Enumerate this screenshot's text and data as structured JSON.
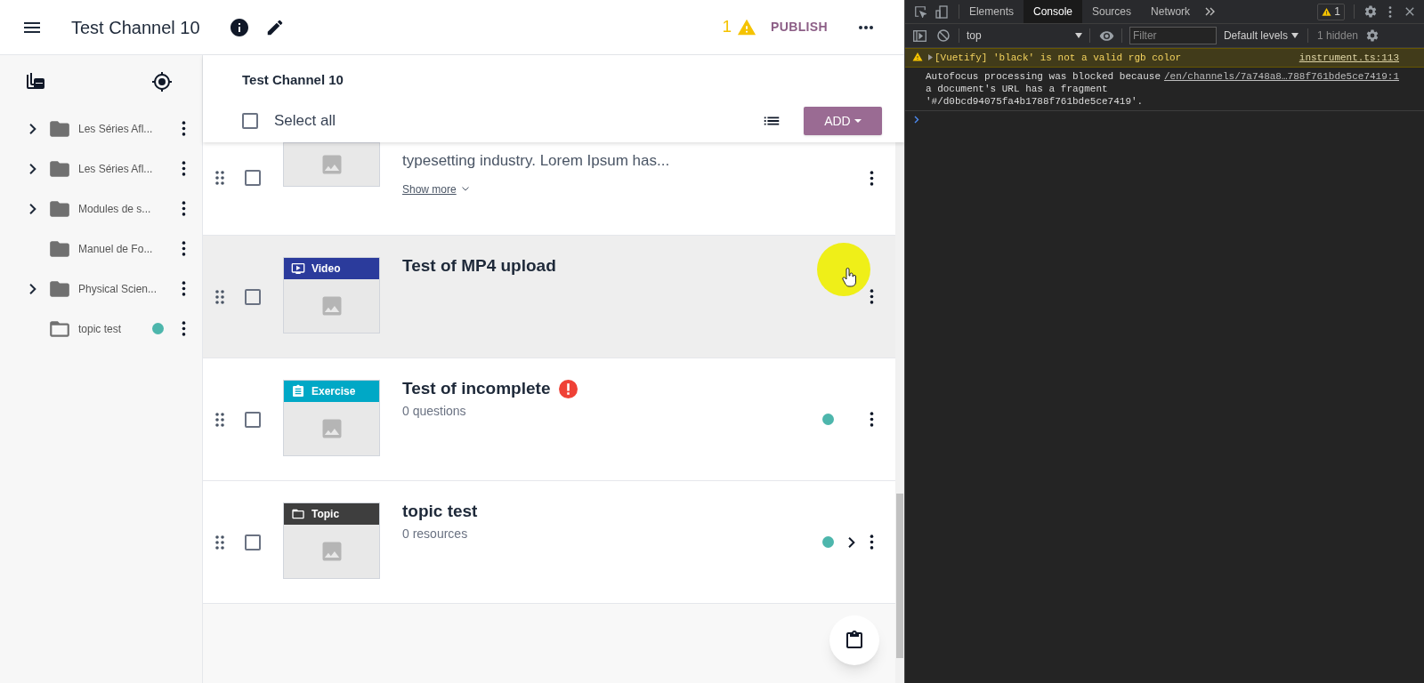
{
  "app_bar": {
    "title": "Test Channel 10",
    "warning_count": "1",
    "publish": "PUBLISH"
  },
  "sidebar": {
    "items": [
      {
        "label": "Les Séries Afl...",
        "kind": "folder",
        "expandable": true,
        "changed": false
      },
      {
        "label": "Les Séries Afl...",
        "kind": "folder",
        "expandable": true,
        "changed": false
      },
      {
        "label": "Modules de s...",
        "kind": "folder",
        "expandable": true,
        "changed": false
      },
      {
        "label": "Manuel de Fo...",
        "kind": "folder",
        "expandable": false,
        "changed": false
      },
      {
        "label": "Physical Scien...",
        "kind": "folder",
        "expandable": true,
        "changed": false
      },
      {
        "label": "topic test",
        "kind": "topic",
        "expandable": false,
        "changed": true
      }
    ]
  },
  "content": {
    "title": "Test Channel 10",
    "select_all": {
      "label": "Select all",
      "checked": false
    },
    "add_button": "ADD",
    "rows": [
      {
        "kind": "cut",
        "description": "typesetting industry. Lorem Ipsum has...",
        "show_more": "Show more",
        "checked": false,
        "hovered": false,
        "changed": false,
        "incomplete": false
      },
      {
        "kind": "video",
        "badge": "Video",
        "title": "Test of MP4 upload",
        "checked": false,
        "hovered": true,
        "changed": false,
        "incomplete": false
      },
      {
        "kind": "exercise",
        "badge": "Exercise",
        "title": "Test of incomplete",
        "subtitle": "0 questions",
        "checked": false,
        "hovered": false,
        "changed": true,
        "incomplete": true
      },
      {
        "kind": "topic",
        "badge": "Topic",
        "title": "topic test",
        "subtitle": "0 resources",
        "checked": false,
        "hovered": false,
        "changed": true,
        "incomplete": false
      }
    ]
  },
  "devtools": {
    "tabs": [
      {
        "label": "Elements",
        "selected": false
      },
      {
        "label": "Console",
        "selected": true
      },
      {
        "label": "Sources",
        "selected": false
      },
      {
        "label": "Network",
        "selected": false
      }
    ],
    "warning_count": "1",
    "context": "top",
    "filter_placeholder": "Filter",
    "levels": "Default levels",
    "hidden": "1 hidden",
    "messages": [
      {
        "kind": "warning",
        "text": "[Vuetify] 'black' is not a valid rgb color",
        "source": "instrument.ts:113"
      },
      {
        "kind": "info",
        "text": "Autofocus processing was blocked because a document's URL has a fragment '#/d0bcd94075fa4b1788f761bde5ce7419'.",
        "source": "/en/channels/7a748a8…788f761bde5ce7419:1"
      }
    ]
  }
}
